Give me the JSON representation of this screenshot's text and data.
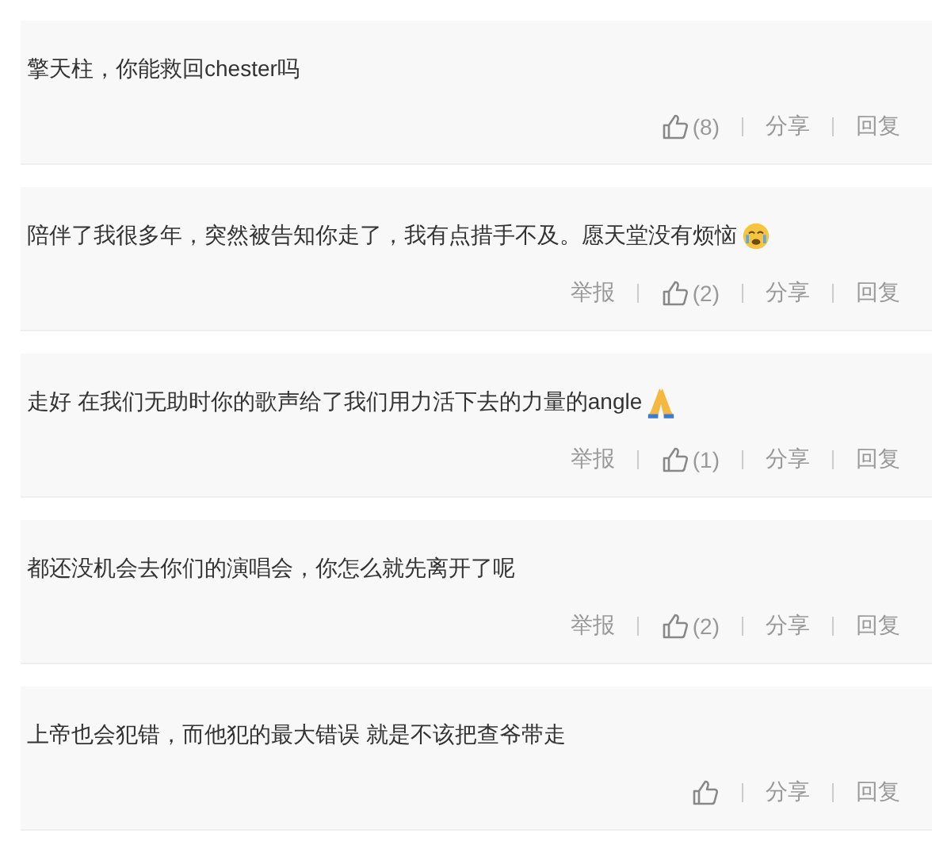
{
  "comments": [
    {
      "kind": "plain",
      "text": "擎天柱，你能救回chester吗",
      "actions": [
        {
          "kind": "like",
          "label": "(8)"
        },
        {
          "kind": "share",
          "label": "分享"
        },
        {
          "kind": "reply",
          "label": "回复"
        }
      ]
    },
    {
      "kind": "crying",
      "text": "陪伴了我很多年，突然被告知你走了，我有点措手不及。愿天堂没有烦恼",
      "actions": [
        {
          "kind": "report",
          "label": "举报"
        },
        {
          "kind": "like",
          "label": "(2)"
        },
        {
          "kind": "share",
          "label": "分享"
        },
        {
          "kind": "reply",
          "label": "回复"
        }
      ]
    },
    {
      "kind": "praying",
      "text": "走好 在我们无助时你的歌声给了我们用力活下去的力量的angle",
      "actions": [
        {
          "kind": "report",
          "label": "举报"
        },
        {
          "kind": "like",
          "label": "(1)"
        },
        {
          "kind": "share",
          "label": "分享"
        },
        {
          "kind": "reply",
          "label": "回复"
        }
      ]
    },
    {
      "kind": "plain",
      "text": "都还没机会去你们的演唱会，你怎么就先离开了呢",
      "actions": [
        {
          "kind": "report",
          "label": "举报"
        },
        {
          "kind": "like",
          "label": "(2)"
        },
        {
          "kind": "share",
          "label": "分享"
        },
        {
          "kind": "reply",
          "label": "回复"
        }
      ]
    },
    {
      "kind": "plain",
      "text": "上帝也会犯错，而他犯的最大错误 就是不该把查爷带走",
      "actions": [
        {
          "kind": "like"
        },
        {
          "kind": "share",
          "label": "分享"
        },
        {
          "kind": "reply",
          "label": "回复"
        }
      ]
    }
  ]
}
